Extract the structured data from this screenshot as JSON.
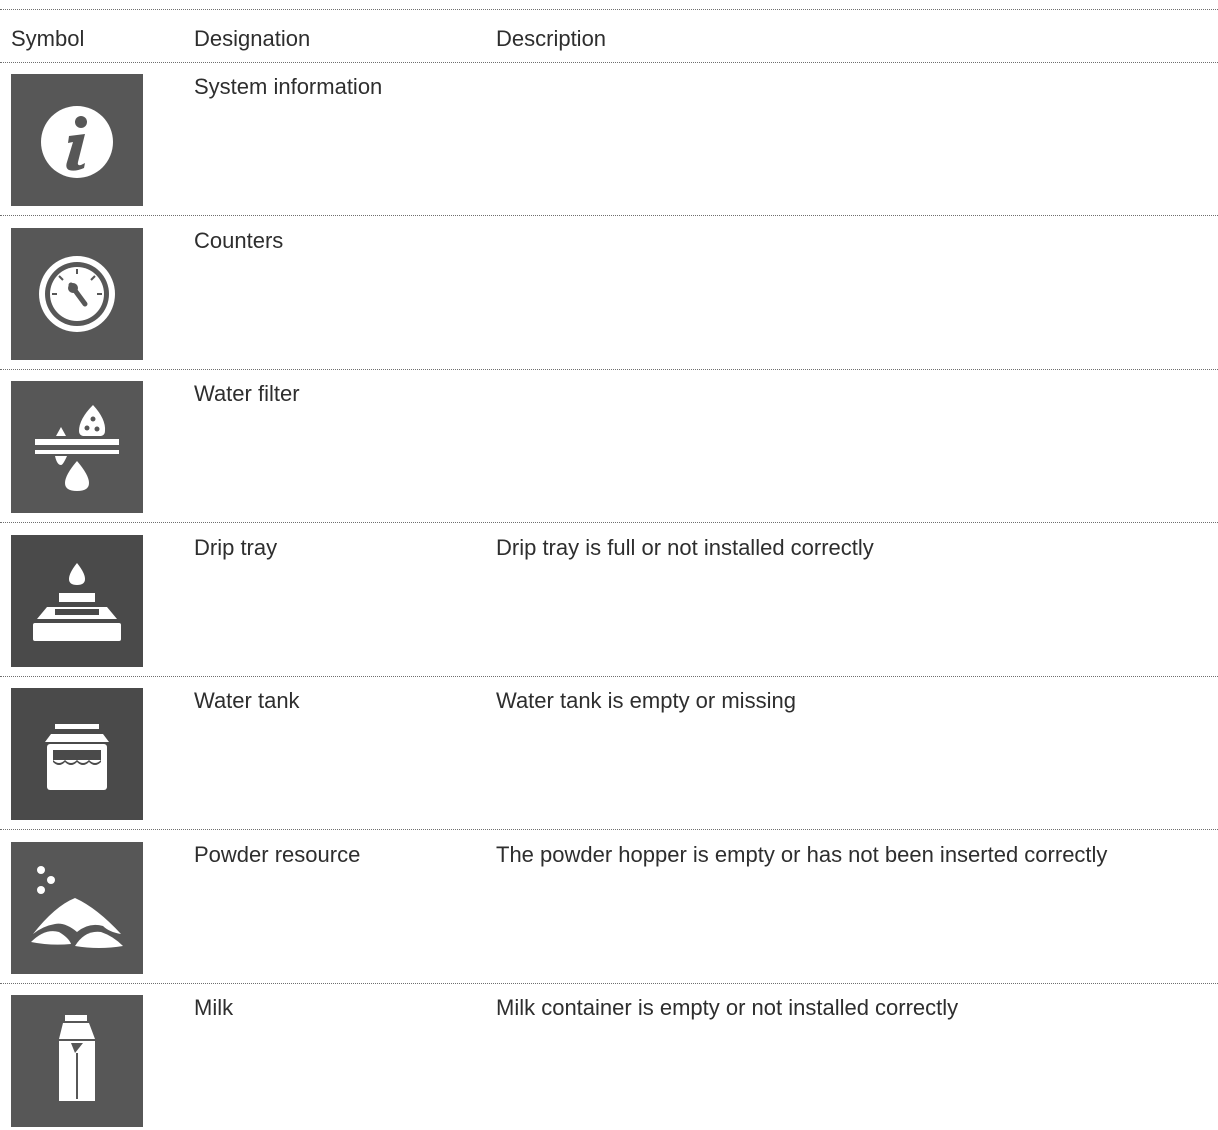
{
  "header": {
    "symbol": "Symbol",
    "designation": "Designation",
    "description": "Description"
  },
  "rows": [
    {
      "icon": "info-icon",
      "designation": "System information",
      "description": ""
    },
    {
      "icon": "gauge-icon",
      "designation": "Counters",
      "description": ""
    },
    {
      "icon": "water-filter-icon",
      "designation": "Water filter",
      "description": ""
    },
    {
      "icon": "drip-tray-icon",
      "designation": "Drip tray",
      "description": "Drip tray is full or not installed correctly"
    },
    {
      "icon": "water-tank-icon",
      "designation": "Water tank",
      "description": "Water tank is empty or missing"
    },
    {
      "icon": "powder-icon",
      "designation": "Powder resource",
      "description": "The powder hopper is empty or has not been inserted correctly"
    },
    {
      "icon": "milk-carton-icon",
      "designation": "Milk",
      "description": "Milk container is empty or not installed correctly"
    }
  ],
  "colors": {
    "icon_bg": "#575757",
    "icon_bg_dark": "#4a4a4a",
    "text": "#2e2e2e"
  }
}
